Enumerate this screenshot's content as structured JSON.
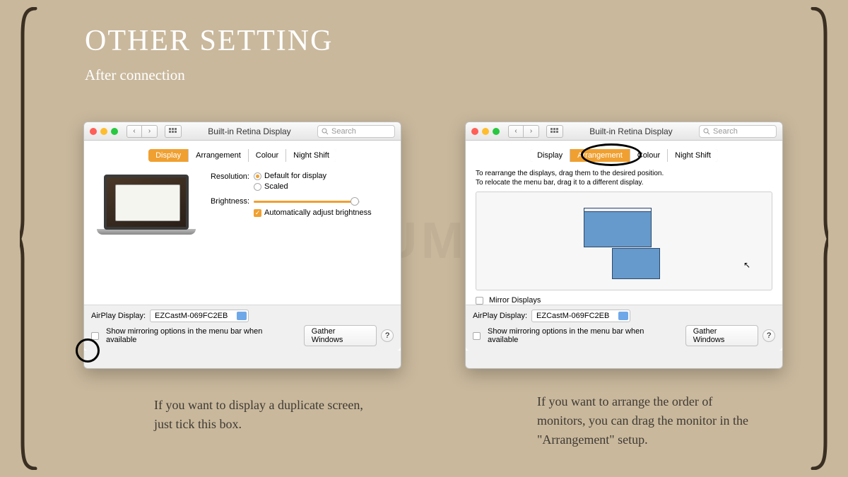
{
  "page": {
    "title": "OTHER SETTING",
    "subtitle": "After connection"
  },
  "window": {
    "title": "Built-in Retina Display",
    "search_placeholder": "Search"
  },
  "tabs": {
    "display": "Display",
    "arrangement": "Arrangement",
    "colour": "Colour",
    "night_shift": "Night Shift"
  },
  "display_panel": {
    "resolution_label": "Resolution:",
    "resolution_default": "Default for display",
    "resolution_scaled": "Scaled",
    "brightness_label": "Brightness:",
    "auto_brightness": "Automatically adjust brightness"
  },
  "arrangement_panel": {
    "hint_line1": "To rearrange the displays, drag them to the desired position.",
    "hint_line2": "To relocate the menu bar, drag it to a different display.",
    "mirror_displays": "Mirror Displays"
  },
  "footer": {
    "airplay_label": "AirPlay Display:",
    "airplay_value": "EZCastM-069FC2EB",
    "mirror_checkbox": "Show mirroring options in the menu bar when available",
    "gather_windows": "Gather Windows",
    "help": "?"
  },
  "captions": {
    "left": "If you want to display a duplicate screen, just tick this box.",
    "right": "If you want to arrange the order of monitors, you can drag the monitor in the \"Arrangement\" setup."
  },
  "watermark": "LEXUMA"
}
